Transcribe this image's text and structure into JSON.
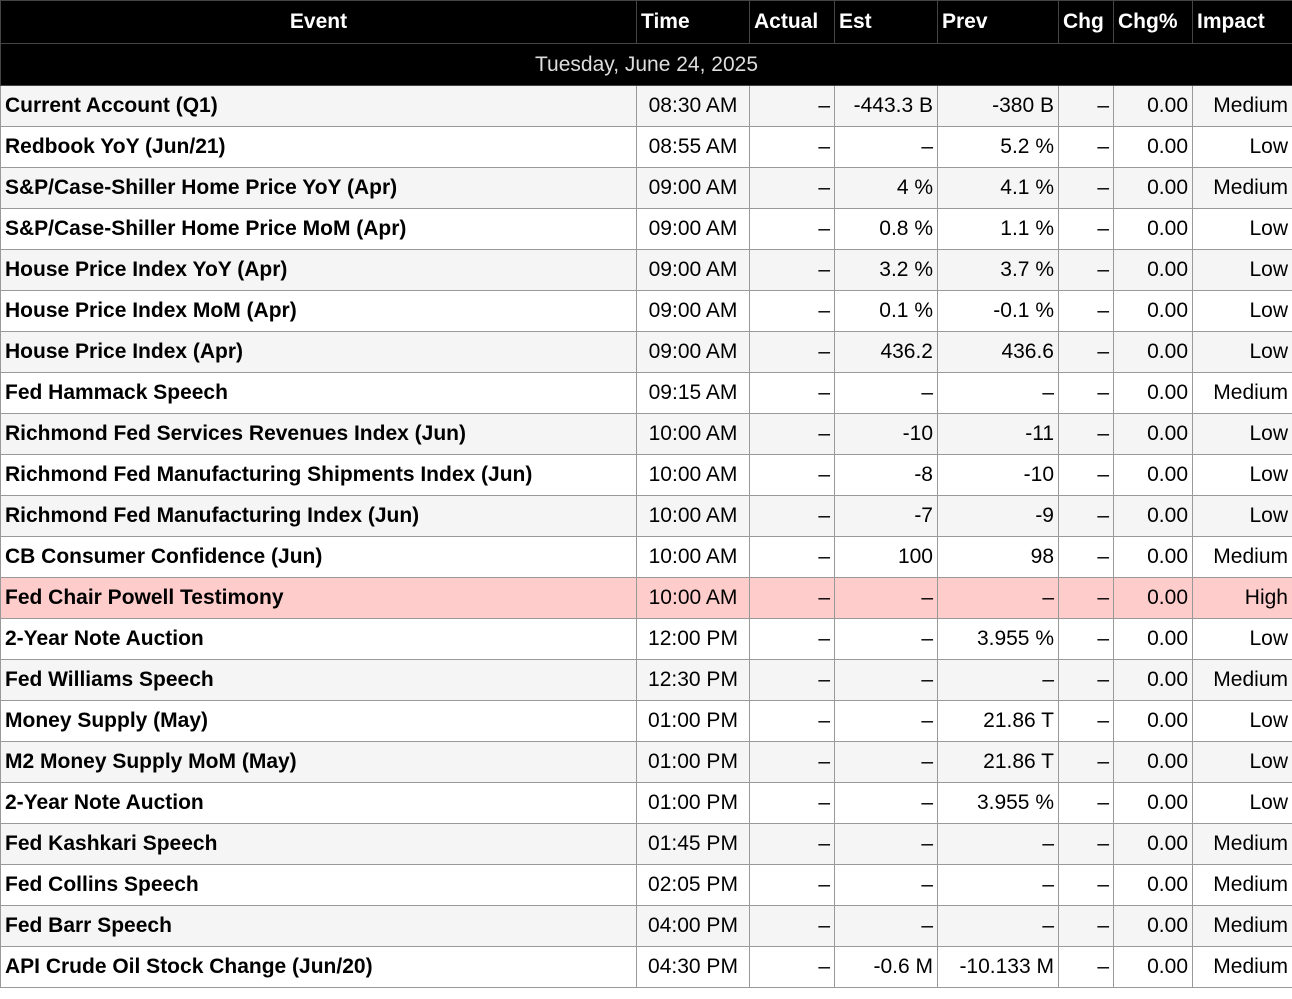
{
  "headers": {
    "event": "Event",
    "time": "Time",
    "actual": "Actual",
    "est": "Est",
    "prev": "Prev",
    "chg": "Chg",
    "chg_pct": "Chg%",
    "impact": "Impact"
  },
  "date_label": "Tuesday, June 24, 2025",
  "events": [
    {
      "event": "Current Account (Q1)",
      "time": "08:30 AM",
      "actual": "–",
      "est": "-443.3 B",
      "prev": "-380 B",
      "chg": "–",
      "chg_pct": "0.00",
      "impact": "Medium"
    },
    {
      "event": "Redbook YoY (Jun/21)",
      "time": "08:55 AM",
      "actual": "–",
      "est": "–",
      "prev": "5.2 %",
      "chg": "–",
      "chg_pct": "0.00",
      "impact": "Low"
    },
    {
      "event": "S&P/Case-Shiller Home Price YoY (Apr)",
      "time": "09:00 AM",
      "actual": "–",
      "est": "4 %",
      "prev": "4.1 %",
      "chg": "–",
      "chg_pct": "0.00",
      "impact": "Medium"
    },
    {
      "event": "S&P/Case-Shiller Home Price MoM (Apr)",
      "time": "09:00 AM",
      "actual": "–",
      "est": "0.8 %",
      "prev": "1.1 %",
      "chg": "–",
      "chg_pct": "0.00",
      "impact": "Low"
    },
    {
      "event": "House Price Index YoY (Apr)",
      "time": "09:00 AM",
      "actual": "–",
      "est": "3.2 %",
      "prev": "3.7 %",
      "chg": "–",
      "chg_pct": "0.00",
      "impact": "Low"
    },
    {
      "event": "House Price Index MoM (Apr)",
      "time": "09:00 AM",
      "actual": "–",
      "est": "0.1 %",
      "prev": "-0.1 %",
      "chg": "–",
      "chg_pct": "0.00",
      "impact": "Low"
    },
    {
      "event": "House Price Index (Apr)",
      "time": "09:00 AM",
      "actual": "–",
      "est": "436.2",
      "prev": "436.6",
      "chg": "–",
      "chg_pct": "0.00",
      "impact": "Low"
    },
    {
      "event": "Fed Hammack Speech",
      "time": "09:15 AM",
      "actual": "–",
      "est": "–",
      "prev": "–",
      "chg": "–",
      "chg_pct": "0.00",
      "impact": "Medium"
    },
    {
      "event": "Richmond Fed Services Revenues Index (Jun)",
      "time": "10:00 AM",
      "actual": "–",
      "est": "-10",
      "prev": "-11",
      "chg": "–",
      "chg_pct": "0.00",
      "impact": "Low"
    },
    {
      "event": "Richmond Fed Manufacturing Shipments Index (Jun)",
      "time": "10:00 AM",
      "actual": "–",
      "est": "-8",
      "prev": "-10",
      "chg": "–",
      "chg_pct": "0.00",
      "impact": "Low"
    },
    {
      "event": "Richmond Fed Manufacturing Index (Jun)",
      "time": "10:00 AM",
      "actual": "–",
      "est": "-7",
      "prev": "-9",
      "chg": "–",
      "chg_pct": "0.00",
      "impact": "Low"
    },
    {
      "event": "CB Consumer Confidence (Jun)",
      "time": "10:00 AM",
      "actual": "–",
      "est": "100",
      "prev": "98",
      "chg": "–",
      "chg_pct": "0.00",
      "impact": "Medium"
    },
    {
      "event": "Fed Chair Powell Testimony",
      "time": "10:00 AM",
      "actual": "–",
      "est": "–",
      "prev": "–",
      "chg": "–",
      "chg_pct": "0.00",
      "impact": "High"
    },
    {
      "event": "2-Year Note Auction",
      "time": "12:00 PM",
      "actual": "–",
      "est": "–",
      "prev": "3.955 %",
      "chg": "–",
      "chg_pct": "0.00",
      "impact": "Low"
    },
    {
      "event": "Fed Williams Speech",
      "time": "12:30 PM",
      "actual": "–",
      "est": "–",
      "prev": "–",
      "chg": "–",
      "chg_pct": "0.00",
      "impact": "Medium"
    },
    {
      "event": "Money Supply (May)",
      "time": "01:00 PM",
      "actual": "–",
      "est": "–",
      "prev": "21.86 T",
      "chg": "–",
      "chg_pct": "0.00",
      "impact": "Low"
    },
    {
      "event": "M2 Money Supply MoM (May)",
      "time": "01:00 PM",
      "actual": "–",
      "est": "–",
      "prev": "21.86 T",
      "chg": "–",
      "chg_pct": "0.00",
      "impact": "Low"
    },
    {
      "event": "2-Year Note Auction",
      "time": "01:00 PM",
      "actual": "–",
      "est": "–",
      "prev": "3.955 %",
      "chg": "–",
      "chg_pct": "0.00",
      "impact": "Low"
    },
    {
      "event": "Fed Kashkari Speech",
      "time": "01:45 PM",
      "actual": "–",
      "est": "–",
      "prev": "–",
      "chg": "–",
      "chg_pct": "0.00",
      "impact": "Medium"
    },
    {
      "event": "Fed Collins Speech",
      "time": "02:05 PM",
      "actual": "–",
      "est": "–",
      "prev": "–",
      "chg": "–",
      "chg_pct": "0.00",
      "impact": "Medium"
    },
    {
      "event": "Fed Barr Speech",
      "time": "04:00 PM",
      "actual": "–",
      "est": "–",
      "prev": "–",
      "chg": "–",
      "chg_pct": "0.00",
      "impact": "Medium"
    },
    {
      "event": "API Crude Oil Stock Change (Jun/20)",
      "time": "04:30 PM",
      "actual": "–",
      "est": "-0.6 M",
      "prev": "-10.133 M",
      "chg": "–",
      "chg_pct": "0.00",
      "impact": "Medium"
    }
  ],
  "colors": {
    "header_bg": "#000000",
    "header_text": "#ffffff",
    "high_impact_row": "#ffcccc",
    "row_alt": "#f5f5f5"
  }
}
